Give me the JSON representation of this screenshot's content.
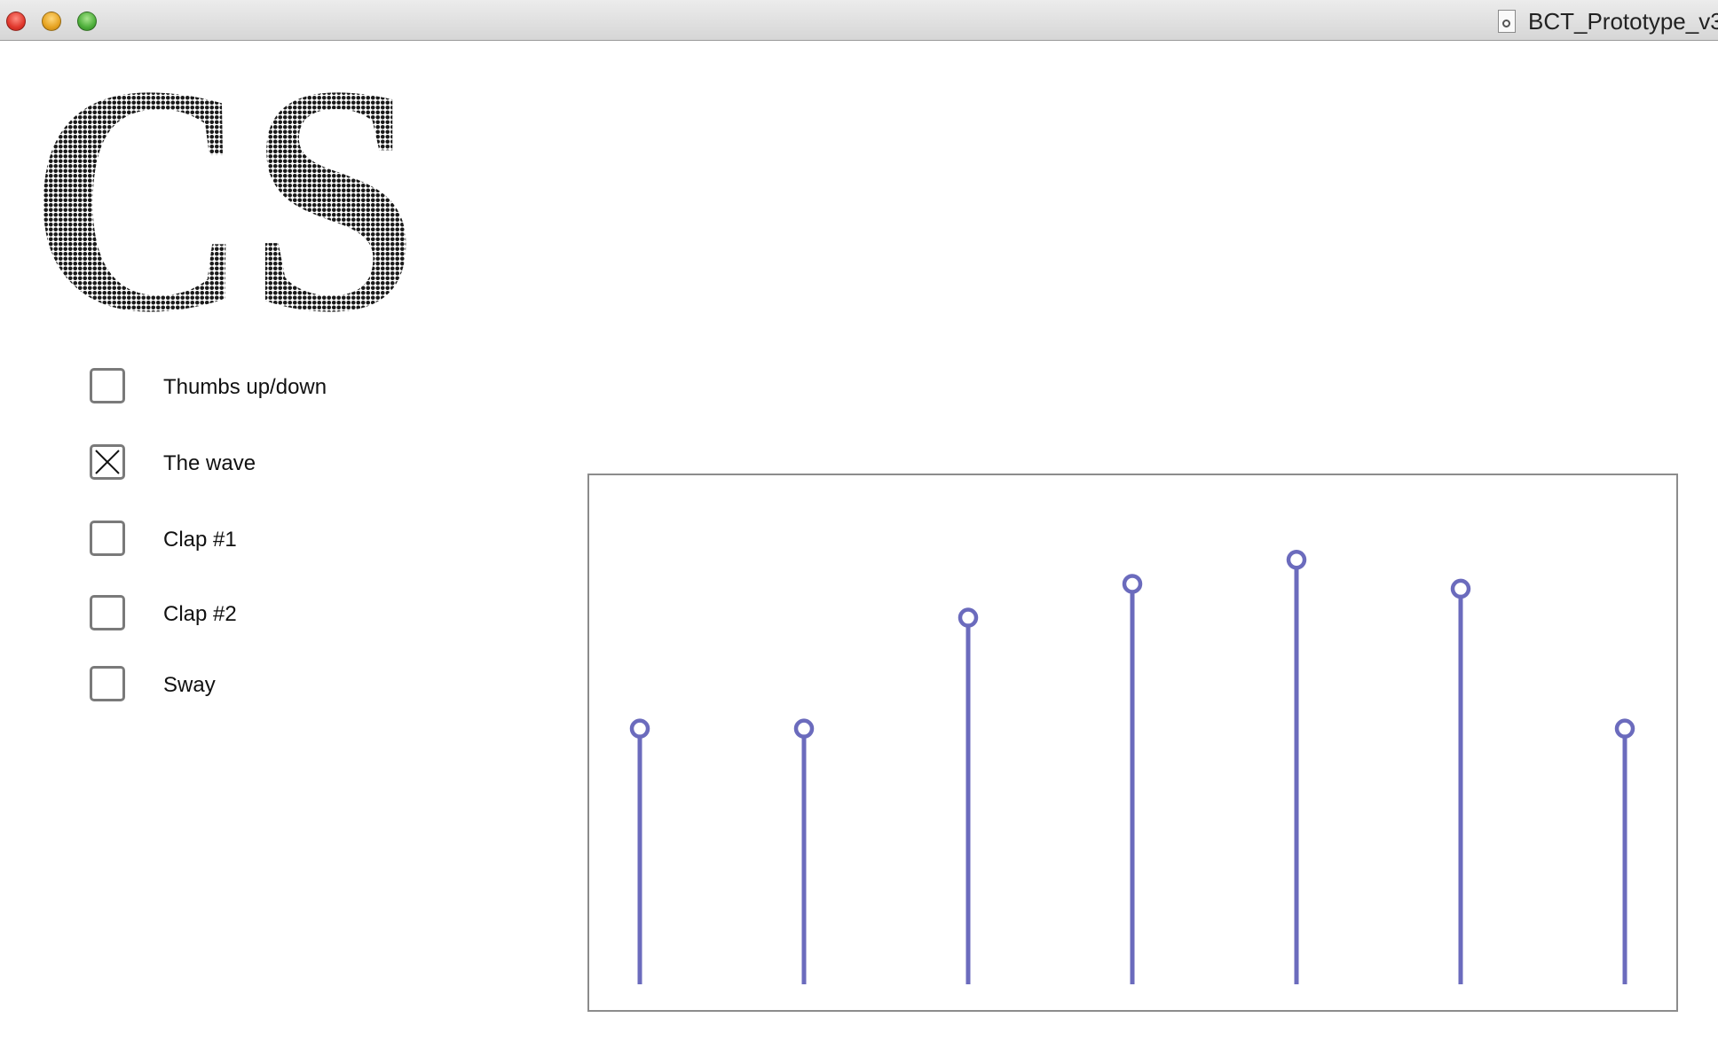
{
  "window": {
    "title": "BCT_Prototype_v3",
    "controls": [
      "close",
      "minimize",
      "zoom"
    ]
  },
  "logo": {
    "text": "CS",
    "icon": "dotted-cs-logo"
  },
  "options": [
    {
      "label": "Thumbs up/down",
      "checked": false
    },
    {
      "label": "The wave",
      "checked": true
    },
    {
      "label": "Clap #1",
      "checked": false
    },
    {
      "label": "Clap #2",
      "checked": false
    },
    {
      "label": "Sway",
      "checked": false
    }
  ],
  "colors": {
    "stem": "#6b6bbd",
    "checkbox_border": "#7a7a7a"
  },
  "chart_data": {
    "type": "stem",
    "x": [
      1,
      2,
      3,
      4,
      5,
      6,
      7
    ],
    "values": [
      0.53,
      0.53,
      0.76,
      0.83,
      0.88,
      0.82,
      0.53
    ],
    "ylim": [
      0,
      1
    ],
    "grid": false,
    "title": "",
    "xlabel": "",
    "ylabel": ""
  }
}
